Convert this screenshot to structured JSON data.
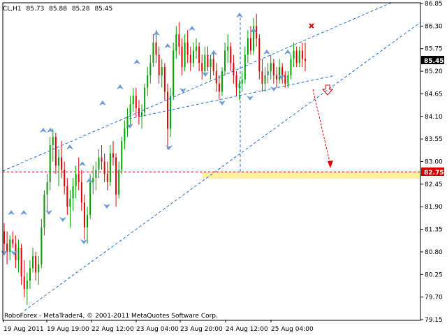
{
  "header": {
    "symbol": "CL,H1",
    "open": "85.73",
    "high": "85.88",
    "low": "85.28",
    "close": "85.45"
  },
  "copyright": "RoboForex - MetaTrader4, © 2001-2011 MetaQuotes Software Corp.",
  "chart_data": {
    "type": "candlestick",
    "title": "CL,H1",
    "ylim": [
      79.0,
      86.95
    ],
    "y_ticks": [
      "86.85",
      "86.30",
      "85.75",
      "85.20",
      "84.65",
      "84.10",
      "83.55",
      "83.00",
      "82.45",
      "81.90",
      "81.35",
      "80.80",
      "80.25",
      "79.70",
      "79.15"
    ],
    "x_ticks": [
      "19 Aug 2011",
      "19 Aug 19:00",
      "22 Aug 12:00",
      "23 Aug 04:00",
      "23 Aug 20:00",
      "24 Aug 12:00",
      "25 Aug 04:00"
    ],
    "current_price": "85.45",
    "target_price": "82.75",
    "colors": {
      "bull": "#00a000",
      "bear": "#e00000",
      "channel": "#1e6fd9",
      "fractal": "#6a9bd8",
      "target_line": "#e00000",
      "target_zone": "#ffee88",
      "badge": "#d40000"
    }
  }
}
